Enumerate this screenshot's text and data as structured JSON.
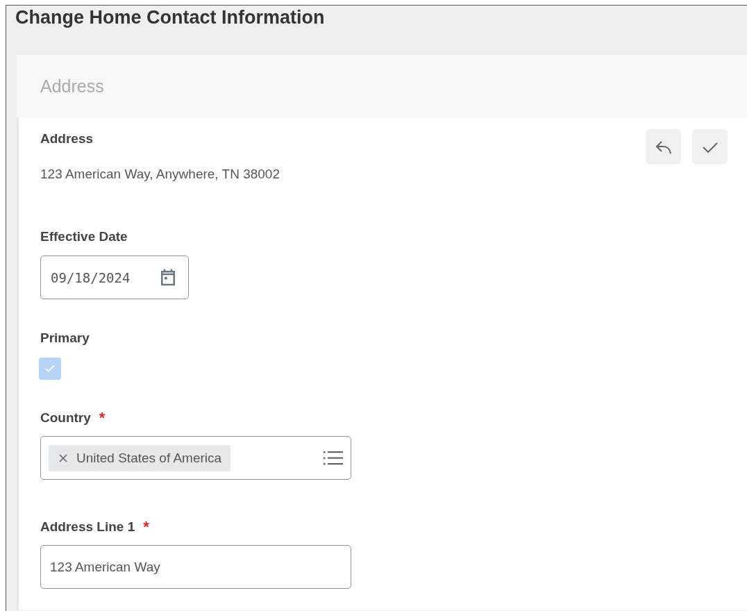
{
  "page_title": "Change Home Contact Information",
  "section": {
    "title": "Address"
  },
  "fields": [
    {
      "kind": "text",
      "label": "Address",
      "value": "123 American Way, Anywhere, TN 38002"
    },
    {
      "kind": "date",
      "label": "Effective Date",
      "value": "09/18/2024"
    },
    {
      "kind": "checkbox",
      "label": "Primary",
      "checked": true,
      "disabled": true
    },
    {
      "kind": "select",
      "label": "Country",
      "marker": "*",
      "chips": [
        "United States of America"
      ]
    },
    {
      "kind": "input",
      "label": "Address Line 1",
      "marker": "*",
      "value": "123 American Way"
    }
  ]
}
